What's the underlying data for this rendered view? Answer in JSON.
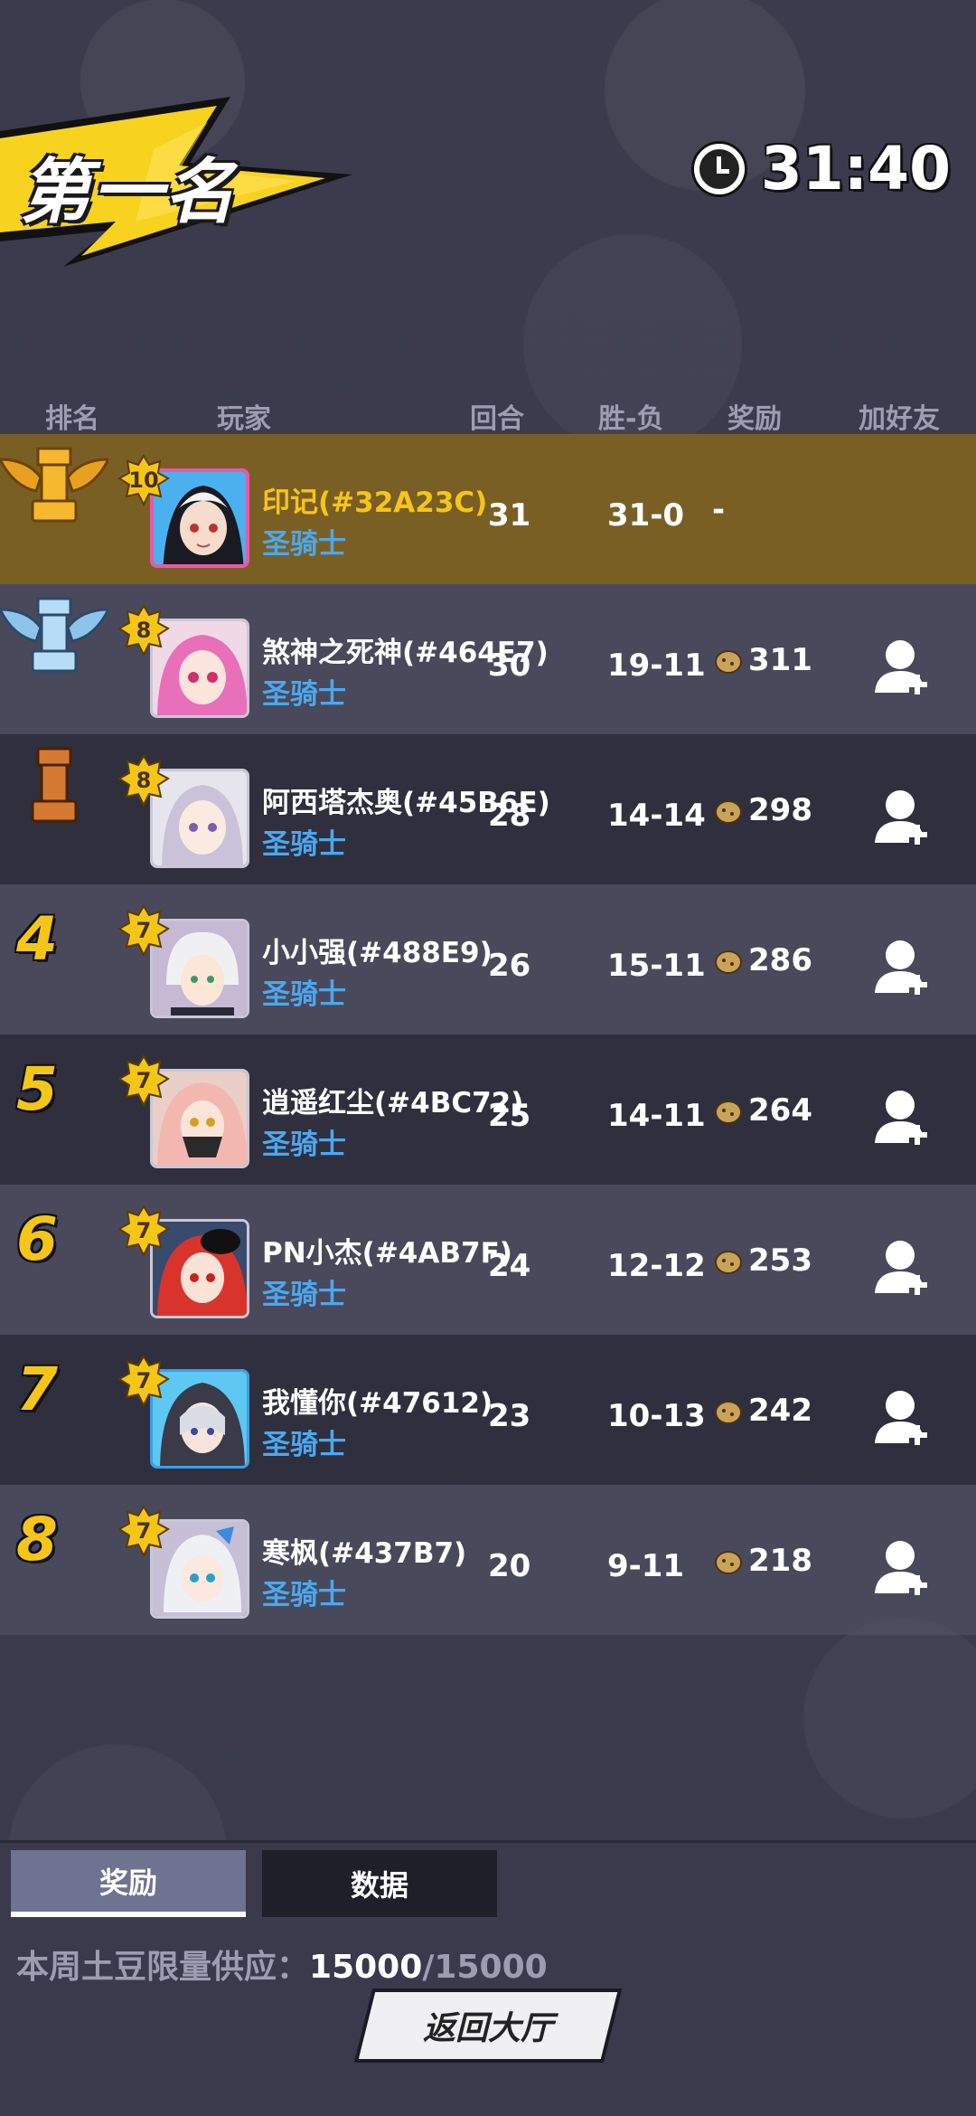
{
  "title": "第一名",
  "timer": "31:40",
  "headers": {
    "rank": "排名",
    "player": "玩家",
    "rounds": "回合",
    "win_loss": "胜-负",
    "reward": "奖励",
    "add_friend": "加好友"
  },
  "players": [
    {
      "rank": "1",
      "level": "10",
      "name": "印记(#32A23C)",
      "class": "圣骑士",
      "rounds": "31",
      "wl": "31-0",
      "reward": "-"
    },
    {
      "rank": "2",
      "level": "8",
      "name": "煞神之死神(#464E7)",
      "class": "圣骑士",
      "rounds": "30",
      "wl": "19-11",
      "reward": "311"
    },
    {
      "rank": "3",
      "level": "8",
      "name": "阿西塔杰奥(#45B6E)",
      "class": "圣骑士",
      "rounds": "28",
      "wl": "14-14",
      "reward": "298"
    },
    {
      "rank": "4",
      "level": "7",
      "name": "小小强(#488E9)",
      "class": "圣骑士",
      "rounds": "26",
      "wl": "15-11",
      "reward": "286"
    },
    {
      "rank": "5",
      "level": "7",
      "name": "逍遥红尘(#4BC72)",
      "class": "圣骑士",
      "rounds": "25",
      "wl": "14-11",
      "reward": "264"
    },
    {
      "rank": "6",
      "level": "7",
      "name": "PN小杰(#4AB7F)",
      "class": "圣骑士",
      "rounds": "24",
      "wl": "12-12",
      "reward": "253"
    },
    {
      "rank": "7",
      "level": "7",
      "name": "我懂你(#47612)",
      "class": "圣骑士",
      "rounds": "23",
      "wl": "10-13",
      "reward": "242"
    },
    {
      "rank": "8",
      "level": "7",
      "name": "寒枫(#437B7)",
      "class": "圣骑士",
      "rounds": "20",
      "wl": "9-11",
      "reward": "218"
    }
  ],
  "tabs": {
    "reward": "奖励",
    "data": "数据"
  },
  "quota": {
    "label": "本周土豆限量供应：",
    "current": "15000",
    "separator": "/",
    "max": "15000"
  },
  "return_button": "返回大厅",
  "colors": {
    "background": "#3a3a4c",
    "first_row": "#7a5f25",
    "gold": "#f5c518",
    "class_blue": "#4aa8f0"
  }
}
